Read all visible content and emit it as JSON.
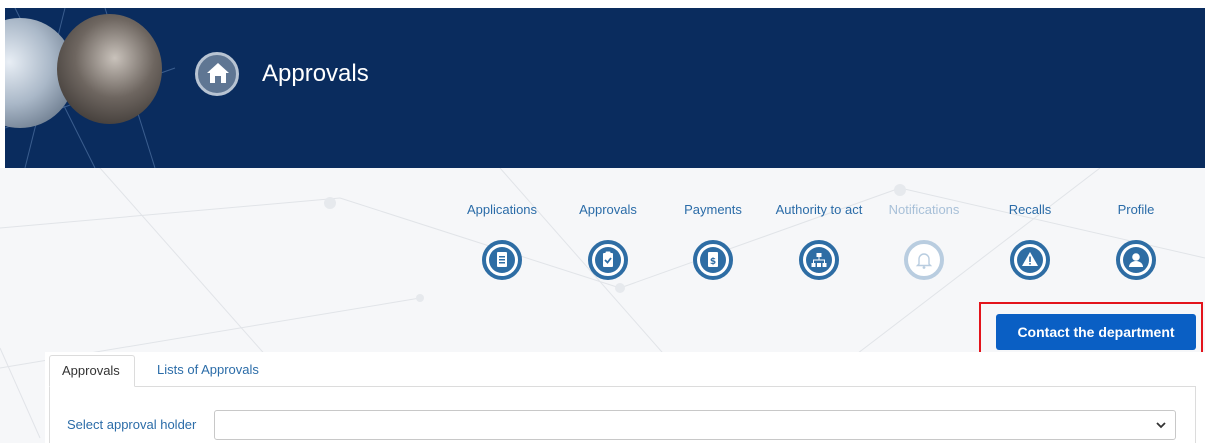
{
  "header": {
    "title": "Approvals"
  },
  "nav": [
    {
      "label": "Applications",
      "icon": "document-icon",
      "enabled": true
    },
    {
      "label": "Approvals",
      "icon": "clipboard-check-icon",
      "enabled": true
    },
    {
      "label": "Payments",
      "icon": "invoice-dollar-icon",
      "enabled": true
    },
    {
      "label": "Authority to act",
      "icon": "org-chart-icon",
      "enabled": true
    },
    {
      "label": "Notifications",
      "icon": "bell-icon",
      "enabled": false
    },
    {
      "label": "Recalls",
      "icon": "warning-triangle-icon",
      "enabled": true
    },
    {
      "label": "Profile",
      "icon": "user-icon",
      "enabled": true
    }
  ],
  "contact": {
    "label": "Contact the department"
  },
  "tabs": [
    {
      "label": "Approvals",
      "active": true
    },
    {
      "label": "Lists of Approvals",
      "active": false
    }
  ],
  "form": {
    "approval_holder_label": "Select approval holder",
    "approval_holder_value": ""
  },
  "colors": {
    "header": "#0a2c5e",
    "primary": "#2e6da4",
    "button": "#0a5fc4",
    "highlight": "#e3141c"
  }
}
